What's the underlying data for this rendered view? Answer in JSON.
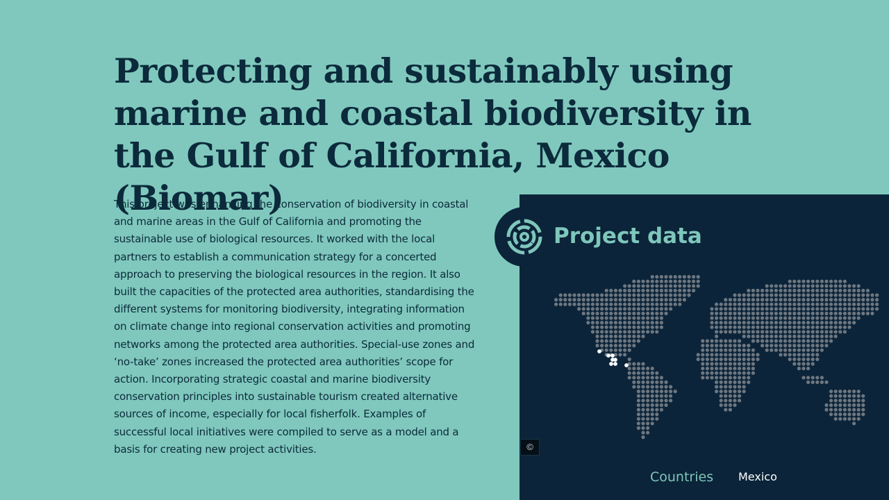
{
  "project": {
    "title": "Protecting and sustainably using marine and coastal biodiversity in the Gulf of California, Mexico (Biomar)",
    "description": "This project was enhancing the conservation of biodiversity in coastal and marine areas in the Gulf of California and promoting the sustainable use of biological resources. It worked with the local partners to establish a communication strategy for a concerted approach to preserving the biological resources in the region. It also built the capacities of the protected area authorities, standardising the different systems for monitoring biodiversity, integrating information on climate change into regional conservation activities and promoting networks among the protected area authorities. Special-use zones and ‘no-take’ zones increased the protected area authorities’ scope for action. Incorporating strategic coastal and marine biodiversity conservation principles into sustainable tourism created alternative sources of income, especially for local fisherfolk. Examples of successful local initiatives were compiled to serve as a model and a basis for creating new project activities."
  },
  "project_data": {
    "heading": "Project data",
    "icon": "project-data-rings-icon",
    "map_icon": "dotted-world-map",
    "copyright_icon": "copyright-icon",
    "copyright_symbol": "©",
    "countries_label": "Countries",
    "countries_value": "Mexico",
    "highlighted_country": "Mexico"
  },
  "colors": {
    "page_background": "#80c8bd",
    "title_text": "#0b2a3b",
    "panel_background": "#0b2439",
    "accent": "#7fc6bb",
    "map_dot": "#6e7780",
    "map_highlight": "#ffffff"
  }
}
